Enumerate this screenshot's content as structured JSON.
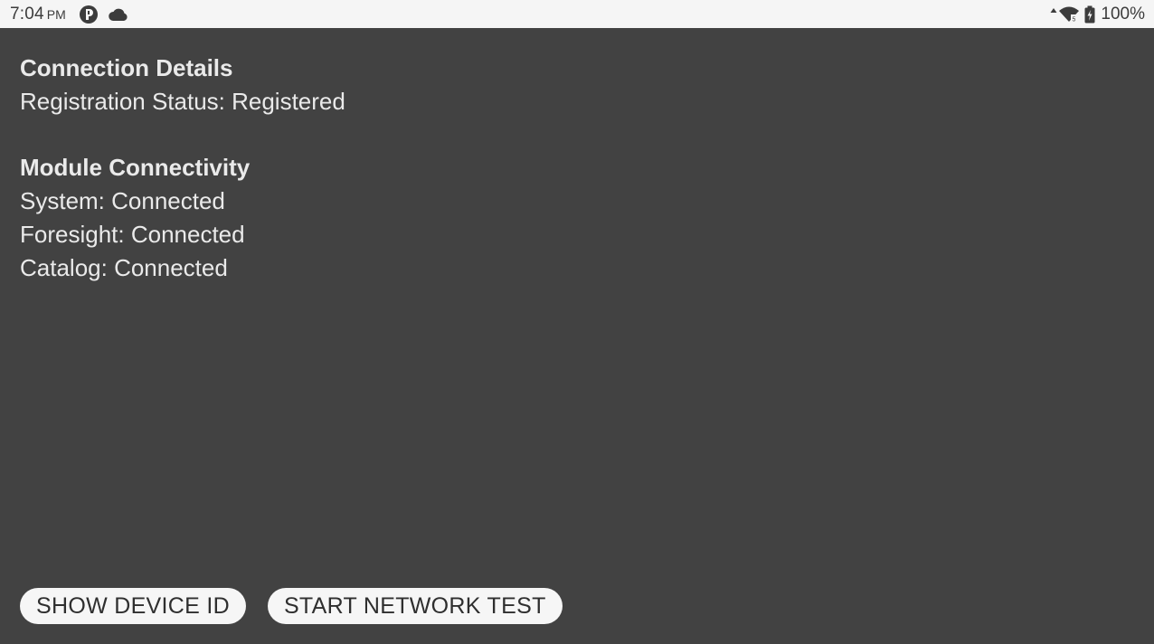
{
  "status_bar": {
    "time": "7:04",
    "ampm": "PM",
    "left_icons": [
      "app-notification-icon",
      "cloud-icon"
    ],
    "right_icons": [
      "data-activity-icon",
      "wifi-icon",
      "battery-charging-icon"
    ],
    "battery": "100%"
  },
  "connection_details": {
    "heading": "Connection Details",
    "registration": "Registration Status: Registered"
  },
  "module_connectivity": {
    "heading": "Module Connectivity",
    "items": [
      "System: Connected",
      "Foresight: Connected",
      "Catalog: Connected"
    ]
  },
  "buttons": {
    "show_device_id": "SHOW DEVICE ID",
    "start_network_test": "START NETWORK TEST"
  },
  "colors": {
    "background": "#424242",
    "status_bar": "#f5f5f5",
    "text": "#eaeaea",
    "button_bg": "#f6f6f6"
  }
}
